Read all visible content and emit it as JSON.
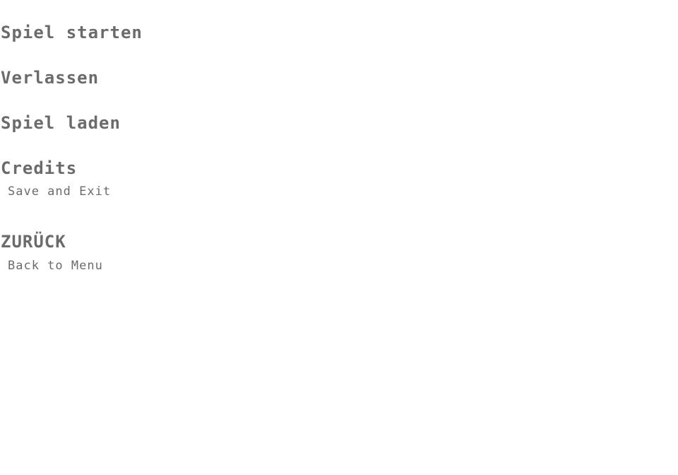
{
  "menu": {
    "start_label": "Spiel starten",
    "quit_label": "Verlassen",
    "load_label": "Spiel laden",
    "credits_label": "Credits",
    "credits_subtitle": "Save and Exit",
    "back_label": "ZURÜCK",
    "back_subtitle": "Back to Menu"
  },
  "colors": {
    "background": "#ffffff",
    "text": "#6b6b6b"
  }
}
